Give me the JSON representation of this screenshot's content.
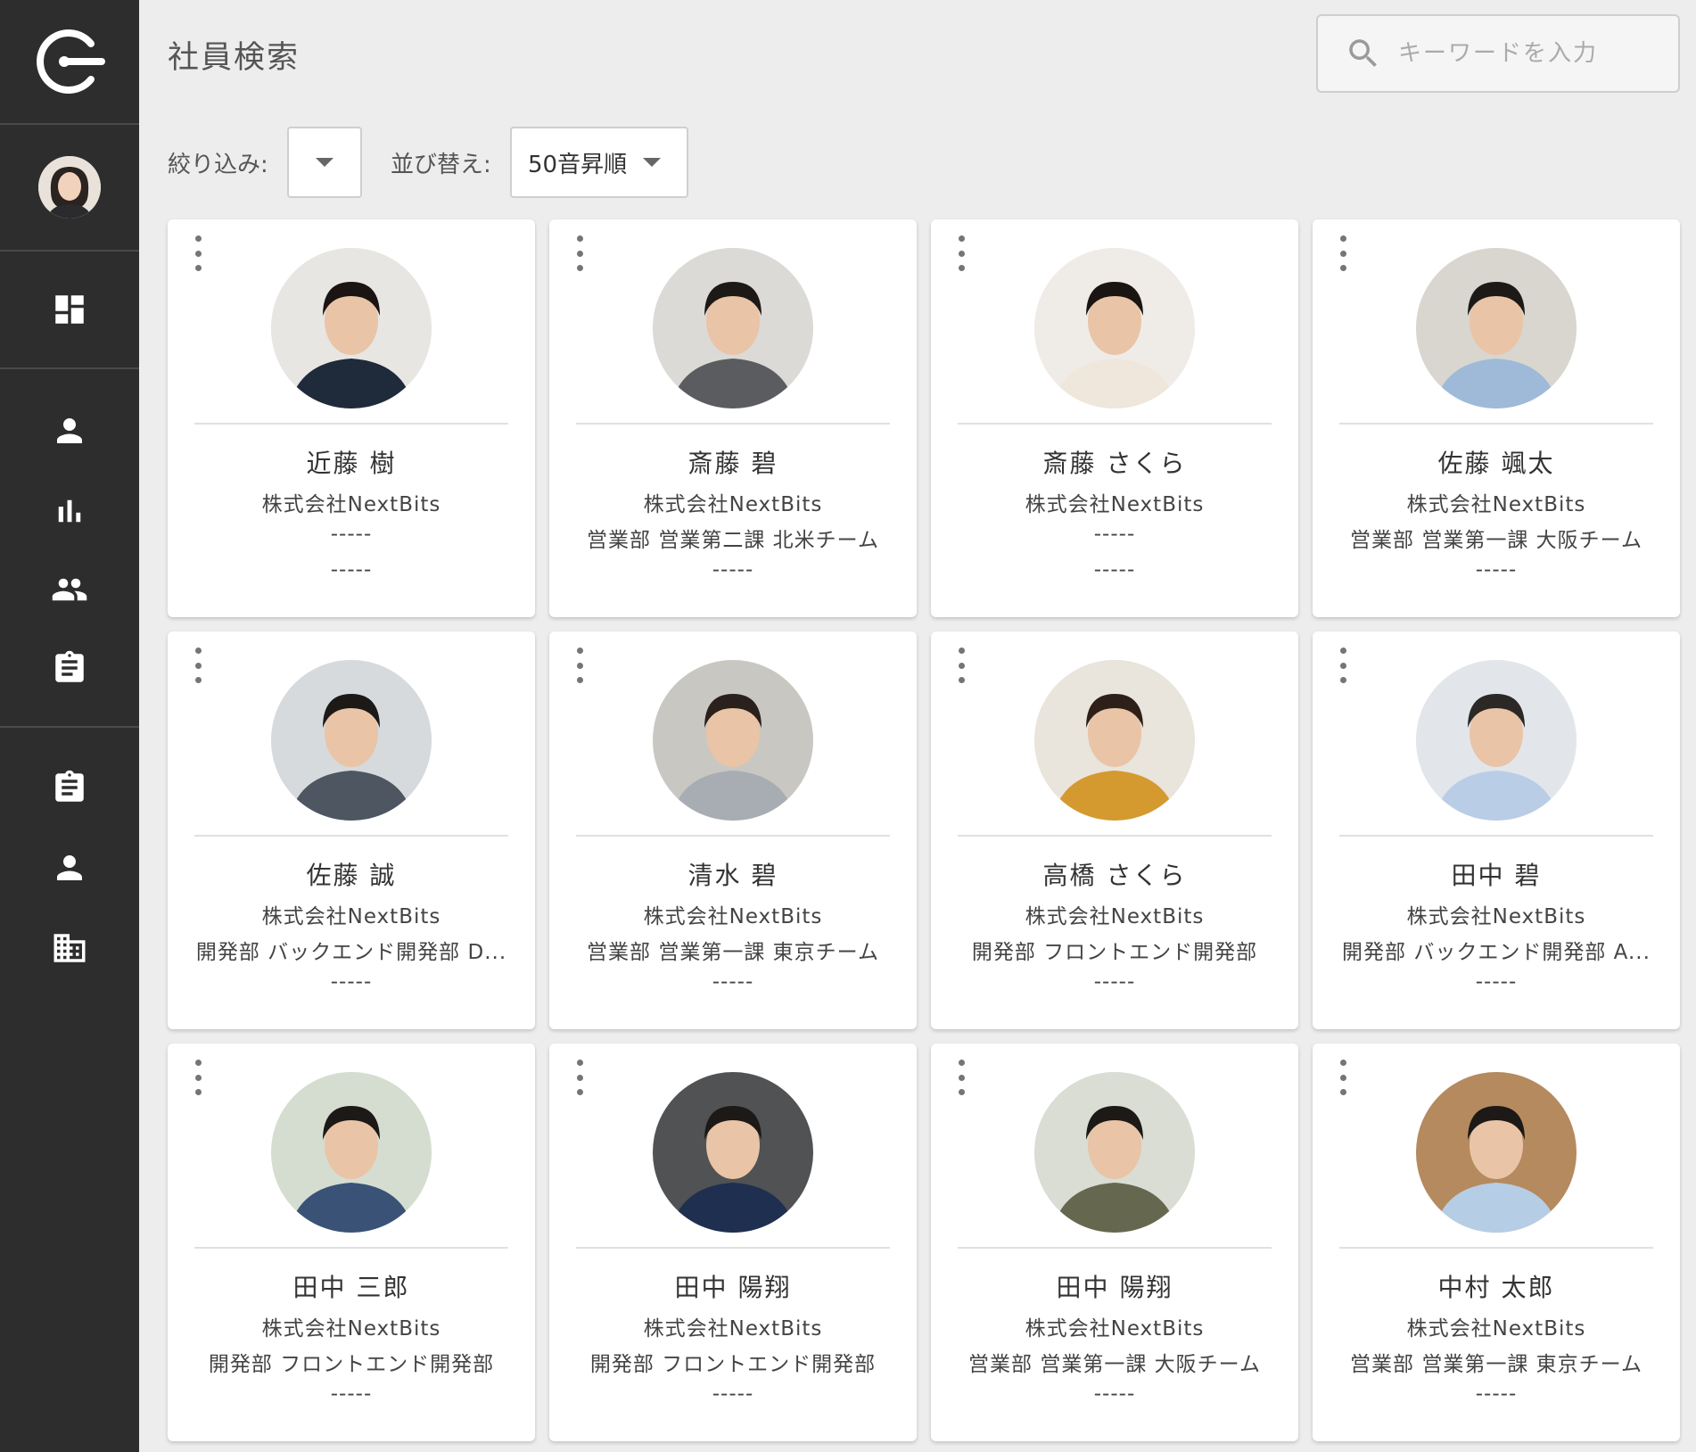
{
  "app": {
    "title": "社員検索"
  },
  "search": {
    "placeholder": "キーワードを入力",
    "value": ""
  },
  "filters": {
    "filter_label": "絞り込み:",
    "filter_value": "",
    "sort_label": "並び替え:",
    "sort_value": "50音昇順"
  },
  "sidebar": {
    "items": [
      {
        "icon": "dashboard-icon"
      },
      {
        "icon": "person-icon"
      },
      {
        "icon": "bar-chart-icon"
      },
      {
        "icon": "group-icon"
      },
      {
        "icon": "clipboard-icon"
      },
      {
        "icon": "clipboard-icon"
      },
      {
        "icon": "person-icon"
      },
      {
        "icon": "building-icon"
      }
    ]
  },
  "employees": [
    {
      "name": "近藤 樹",
      "company": "株式会社NextBits",
      "dept": "-----",
      "extra": "-----"
    },
    {
      "name": "斎藤 碧",
      "company": "株式会社NextBits",
      "dept": "営業部 営業第二課 北米チーム",
      "extra": "-----"
    },
    {
      "name": "斎藤 さくら",
      "company": "株式会社NextBits",
      "dept": "-----",
      "extra": "-----"
    },
    {
      "name": "佐藤 颯太",
      "company": "株式会社NextBits",
      "dept": "営業部 営業第一課 大阪チーム",
      "extra": "-----"
    },
    {
      "name": "佐藤 誠",
      "company": "株式会社NextBits",
      "dept": "開発部 バックエンド開発部 D...",
      "extra": "-----"
    },
    {
      "name": "清水 碧",
      "company": "株式会社NextBits",
      "dept": "営業部 営業第一課 東京チーム",
      "extra": "-----"
    },
    {
      "name": "高橋 さくら",
      "company": "株式会社NextBits",
      "dept": "開発部 フロントエンド開発部",
      "extra": "-----"
    },
    {
      "name": "田中 碧",
      "company": "株式会社NextBits",
      "dept": "開発部 バックエンド開発部 A...",
      "extra": "-----"
    },
    {
      "name": "田中 三郎",
      "company": "株式会社NextBits",
      "dept": "開発部 フロントエンド開発部",
      "extra": "-----"
    },
    {
      "name": "田中 陽翔",
      "company": "株式会社NextBits",
      "dept": "開発部 フロントエンド開発部",
      "extra": "-----"
    },
    {
      "name": "田中 陽翔",
      "company": "株式会社NextBits",
      "dept": "営業部 営業第一課 大阪チーム",
      "extra": "-----"
    },
    {
      "name": "中村 太郎",
      "company": "株式会社NextBits",
      "dept": "営業部 営業第一課 東京チーム",
      "extra": "-----"
    }
  ],
  "colors": {
    "sidebar_bg": "#2d2d2d",
    "page_bg": "#ededed",
    "card_bg": "#ffffff"
  }
}
